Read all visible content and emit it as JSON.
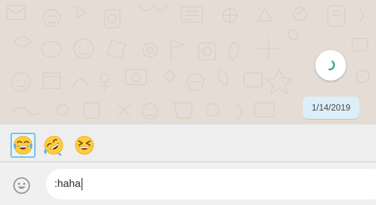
{
  "chat": {
    "date_chip": "1/14/2019",
    "scroll_button_icon": "loading-spinner-icon",
    "accent_color": "#25a28a"
  },
  "emoji_suggestions": [
    {
      "icon": "face-with-tears-of-joy-icon",
      "selected": true
    },
    {
      "icon": "rolling-on-the-floor-laughing-icon",
      "selected": false
    },
    {
      "icon": "grinning-squinting-face-icon",
      "selected": false
    }
  ],
  "composer": {
    "emoji_button_icon": "smiley-icon",
    "input_value": ":haha"
  }
}
